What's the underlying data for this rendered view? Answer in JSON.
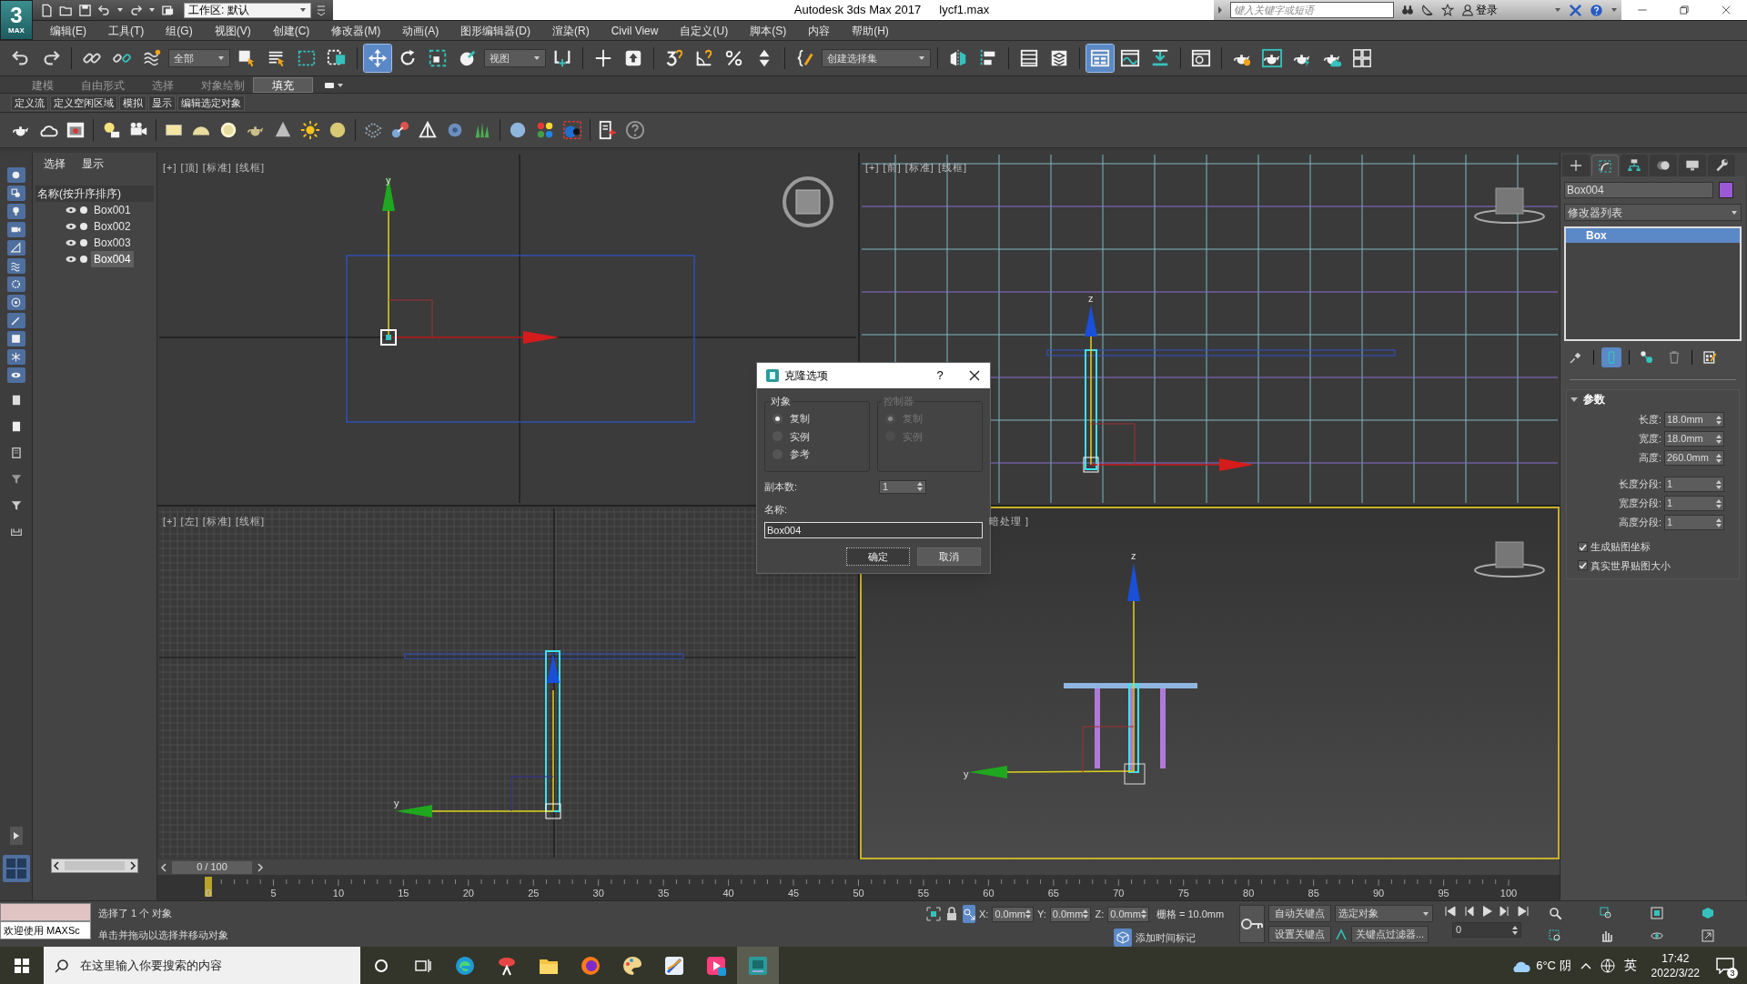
{
  "title_bar": {
    "app_logo": [
      "3",
      "MAX"
    ],
    "workspace": "工作区: 默认",
    "app_title": "Autodesk 3ds Max 2017",
    "file_name": "lycf1.max",
    "search": {
      "placeholder": "键入关键字或短语"
    },
    "sign_in": "登录"
  },
  "menu": [
    "编辑(E)",
    "工具(T)",
    "组(G)",
    "视图(V)",
    "创建(C)",
    "修改器(M)",
    "动画(A)",
    "图形编辑器(D)",
    "渲染(R)",
    "Civil View",
    "自定义(U)",
    "脚本(S)",
    "内容",
    "帮助(H)"
  ],
  "main_toolbar": [
    [
      {
        "kind": "undo",
        "selected": false
      },
      {
        "kind": "redo",
        "selected": false
      }
    ],
    [
      {
        "kind": "link",
        "selected": false
      },
      {
        "kind": "unlink",
        "selected": false
      },
      {
        "kind": "bind",
        "selected": false
      },
      {
        "kind": "dropdown",
        "text": "全部"
      },
      {
        "kind": "select",
        "selected": false
      },
      {
        "kind": "byname",
        "selected": false
      },
      {
        "kind": "rect",
        "selected": false
      },
      {
        "kind": "window",
        "selected": false
      }
    ],
    [
      {
        "kind": "move",
        "selected": true
      },
      {
        "kind": "rotate",
        "selected": false
      },
      {
        "kind": "scale",
        "selected": false
      },
      {
        "kind": "place",
        "selected": false
      },
      {
        "kind": "dropdown",
        "text": "视图"
      },
      {
        "kind": "pivot",
        "selected": false
      }
    ],
    [
      {
        "kind": "manip",
        "selected": false
      },
      {
        "kind": "keyb",
        "selected": false
      }
    ],
    [
      {
        "kind": "snap",
        "selected": false
      },
      {
        "kind": "angle",
        "selected": false
      },
      {
        "kind": "percent",
        "selected": false
      },
      {
        "kind": "spinner",
        "selected": false
      }
    ],
    [
      {
        "kind": "named",
        "selected": false
      },
      {
        "kind": "dropdown",
        "text": "创建选择集"
      }
    ],
    [
      {
        "kind": "mirror",
        "selected": false
      },
      {
        "kind": "align",
        "selected": false
      }
    ],
    [
      {
        "kind": "explorer",
        "selected": false
      },
      {
        "kind": "layers",
        "selected": false
      }
    ],
    [
      {
        "kind": "ribbon",
        "selected": true
      },
      {
        "kind": "curve",
        "selected": false
      },
      {
        "kind": "schematic",
        "selected": false
      }
    ],
    [
      {
        "kind": "rsetup",
        "selected": false
      }
    ],
    [
      {
        "kind": "tgear",
        "selected": false
      },
      {
        "kind": "tframe",
        "selected": false
      },
      {
        "kind": "tbolt",
        "selected": false
      },
      {
        "kind": "tcloud",
        "selected": false
      },
      {
        "kind": "grid4",
        "selected": false
      }
    ]
  ],
  "ribbon": {
    "tabs": [
      {
        "label": "建模",
        "selected": false
      },
      {
        "label": "自由形式",
        "selected": false
      },
      {
        "label": "选择",
        "selected": false
      },
      {
        "label": "对象绘制",
        "selected": false
      },
      {
        "label": "填充",
        "selected": true
      }
    ],
    "subtabs": [
      "定义流",
      "定义空闲区域",
      "模拟",
      "显示",
      "编辑选定对象"
    ]
  },
  "scene_explorer": {
    "tabs": [
      "选择",
      "显示"
    ],
    "column_header": "名称(按升序排序)",
    "items": [
      {
        "name": "Box001",
        "selected": false
      },
      {
        "name": "Box002",
        "selected": false
      },
      {
        "name": "Box003",
        "selected": false
      },
      {
        "name": "Box004",
        "selected": true
      }
    ]
  },
  "viewports": [
    {
      "label": "[+] [顶] [标准] [线框]",
      "kind": "top",
      "active": false,
      "axis_labels": [
        "y"
      ]
    },
    {
      "label": "[+] [前] [标准] [线框]",
      "kind": "front",
      "active": false,
      "axis_labels": [
        "z"
      ]
    },
    {
      "label": "[+] [左] [标准] [线框]",
      "kind": "left",
      "active": false,
      "axis_labels": [
        "y"
      ]
    },
    {
      "label": "暗处理 ]",
      "kind": "perspective",
      "active": true,
      "axis_labels": [
        "z",
        "y"
      ]
    }
  ],
  "command_panel": {
    "tabs": [
      {
        "kind": "create",
        "selected": false
      },
      {
        "kind": "modify",
        "selected": true
      },
      {
        "kind": "hierarchy",
        "selected": false
      },
      {
        "kind": "motion",
        "selected": false
      },
      {
        "kind": "display",
        "selected": false
      },
      {
        "kind": "utilities",
        "selected": false
      }
    ],
    "object_name": "Box004",
    "color": "#9b59d6",
    "modifier_list": "修改器列表",
    "stack": [
      {
        "label": "Box",
        "selected": true
      }
    ],
    "stack_tools": [
      {
        "kind": "pin",
        "selected": false
      },
      {
        "kind": "result",
        "selected": true
      },
      {
        "kind": "unique",
        "selected": false
      },
      {
        "kind": "remove",
        "selected": false
      },
      {
        "kind": "configure",
        "selected": false
      }
    ],
    "rollout": {
      "title": "参数",
      "expanded": true,
      "fields": [
        {
          "label": "长度:",
          "value": "18.0mm"
        },
        {
          "label": "宽度:",
          "value": "18.0mm"
        },
        {
          "label": "高度:",
          "value": "260.0mm"
        }
      ],
      "segment_fields": [
        {
          "label": "长度分段:",
          "value": "1"
        },
        {
          "label": "宽度分段:",
          "value": "1"
        },
        {
          "label": "高度分段:",
          "value": "1"
        }
      ],
      "checkboxes": [
        {
          "label": "生成贴图坐标",
          "checked": true
        },
        {
          "label": "真实世界贴图大小",
          "checked": true
        }
      ]
    }
  },
  "clone_dialog": {
    "title": "克隆选项",
    "help": "?",
    "object_group": {
      "title": "对象",
      "disabled": false,
      "options": [
        {
          "label": "复制",
          "selected": true
        },
        {
          "label": "实例",
          "selected": false
        },
        {
          "label": "参考",
          "selected": false
        }
      ]
    },
    "controller_group": {
      "title": "控制器",
      "disabled": true,
      "options": [
        {
          "label": "复制",
          "selected": true
        },
        {
          "label": "实例",
          "selected": false
        }
      ]
    },
    "copies_label": "副本数:",
    "copies": "1",
    "name_label": "名称:",
    "name": "Box004",
    "buttons": [
      "确定",
      "取消"
    ]
  },
  "timeline": {
    "position": "0 / 100",
    "ticks": [
      "0",
      "5",
      "10",
      "15",
      "20",
      "25",
      "30",
      "35",
      "40",
      "45",
      "50",
      "55",
      "60",
      "65",
      "70",
      "75",
      "80",
      "85",
      "90",
      "95",
      "100"
    ]
  },
  "status": {
    "listener_text": "欢迎使用 MAXSc",
    "selection_info": "选择了 1 个 对象",
    "prompt": "单击并拖动以选择并移动对象",
    "coords": [
      {
        "axis": "X:",
        "value": "0.0mm"
      },
      {
        "axis": "Y:",
        "value": "0.0mm"
      },
      {
        "axis": "Z:",
        "value": "0.0mm"
      }
    ],
    "grid": "栅格 = 10.0mm",
    "add_time_tag": "添加时间标记",
    "auto_key": "自动关键点",
    "key_mode": "选定对象",
    "set_key": "设置关键点",
    "key_filters": "关键点过滤器...",
    "frame": "0"
  },
  "taskbar": {
    "search_placeholder": "在这里输入你要搜索的内容",
    "apps": [
      {
        "kind": "edge",
        "selected": false
      },
      {
        "kind": "snip",
        "selected": false
      },
      {
        "kind": "folder",
        "selected": false
      },
      {
        "kind": "firefox",
        "selected": false
      },
      {
        "kind": "paint",
        "selected": false
      },
      {
        "kind": "pen",
        "selected": false
      },
      {
        "kind": "video",
        "selected": false
      },
      {
        "kind": "max",
        "selected": true
      }
    ],
    "weather": "6°C 阴",
    "ime": "英",
    "time": "17:42",
    "date": "2022/3/22",
    "notifications": "3"
  }
}
